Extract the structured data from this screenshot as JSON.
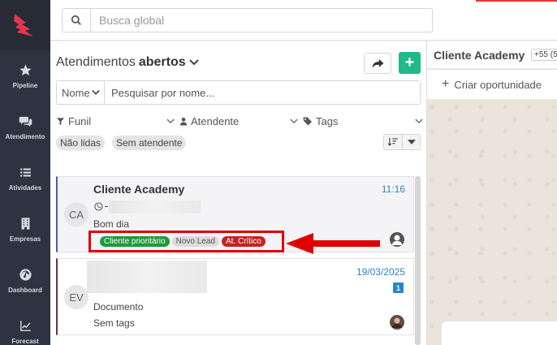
{
  "sidebar": {
    "items": [
      {
        "label": "Pipeline",
        "icon": "star-icon"
      },
      {
        "label": "Atendimento",
        "icon": "chat-icon"
      },
      {
        "label": "Atividades",
        "icon": "list-icon"
      },
      {
        "label": "Empresas",
        "icon": "building-icon"
      },
      {
        "label": "Dashboard",
        "icon": "gauge-icon"
      },
      {
        "label": "Forecast",
        "icon": "chart-line-icon"
      }
    ]
  },
  "search": {
    "placeholder": "Busca global"
  },
  "panel": {
    "title_prefix": "Atendimentos",
    "title_bold": "abertos",
    "add_label": "+",
    "name_select": "Nome",
    "name_placeholder": "Pesquisar por nome...",
    "filters": {
      "funnel": "Funil",
      "agent": "Atendente",
      "tags": "Tags"
    },
    "chips": [
      "Não lidas",
      "Sem atendente"
    ]
  },
  "cards": [
    {
      "initials": "CA",
      "name": "Cliente Academy",
      "time": "11:16",
      "message": "Bom dia",
      "tags": [
        "Cliente prioritário",
        "Novo Lead",
        "At. Crítico"
      ]
    },
    {
      "initials": "EV",
      "date": "19/03/2025",
      "unread": "1",
      "message": "Documento",
      "tags_text": "Sem tags"
    }
  ],
  "right": {
    "title": "Cliente Academy",
    "phone": "+55 (5",
    "create_label": "Criar oportunidade"
  },
  "colors": {
    "accent": "#1fb98a",
    "link": "#2a85c9",
    "sidebar": "#2d3340",
    "highlight": "#e00000"
  }
}
